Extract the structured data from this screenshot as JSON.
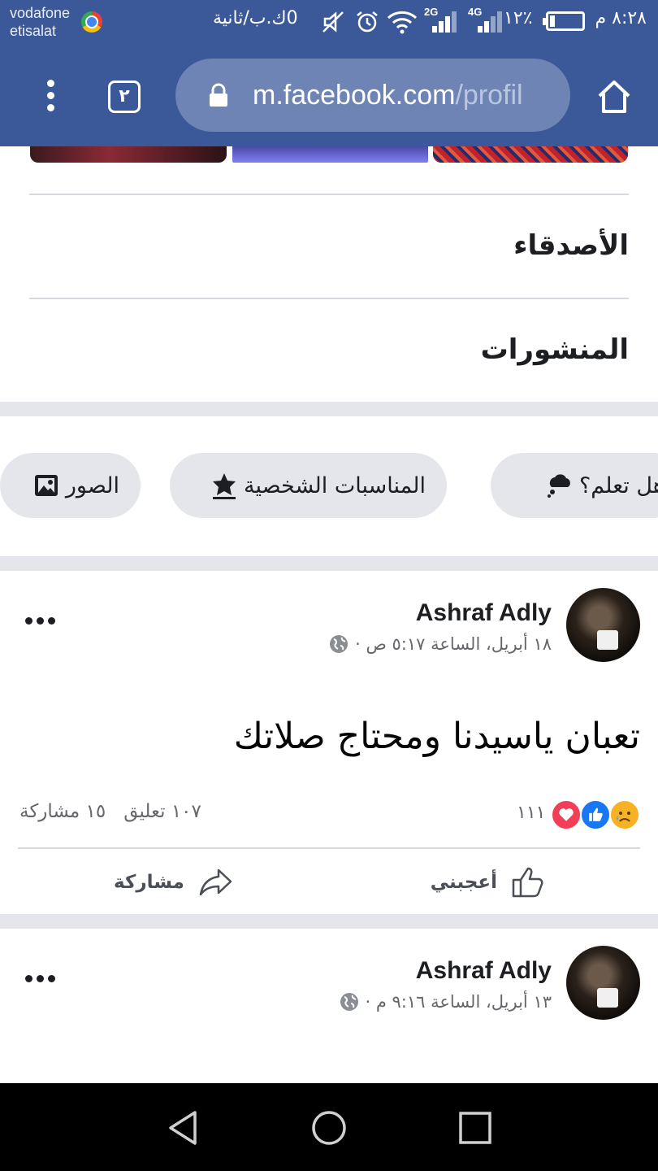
{
  "status_bar": {
    "carrier_line1": "vodafone",
    "carrier_line2": "etisalat",
    "speed": "0ك.ب/ثانية",
    "net1": "2G",
    "net2": "4G",
    "battery_pct": "٪١٢",
    "battery_level": 0.12,
    "time": "٨:٢٨ م"
  },
  "browser": {
    "tab_count": "٢",
    "url_host": "m.facebook.com",
    "url_path": "/profil"
  },
  "sections": {
    "friends": "الأصدقاء",
    "posts": "المنشورات"
  },
  "chips": [
    {
      "label": "هل تعلم؟",
      "icon": "thought-bubble-icon"
    },
    {
      "label": "المناسبات الشخصية",
      "icon": "star-event-icon"
    },
    {
      "label": "الصور",
      "icon": "photos-icon"
    }
  ],
  "posts": [
    {
      "author": "Ashraf Adly",
      "date": "١٨ أبريل، الساعة ٥:١٧ ص ·",
      "text": "تعبان ياسيدنا ومحتاج صلاتك",
      "reaction_count": "١١١",
      "comments": "١٠٧ تعليق",
      "shares": "١٥ مشاركة"
    },
    {
      "author": "Ashraf Adly",
      "date": "١٣ أبريل، الساعة ٩:١٦ م ·"
    }
  ],
  "actions": {
    "like": "أعجبني",
    "share": "مشاركة"
  },
  "colors": {
    "facebook_blue": "#3b5998",
    "like_blue": "#1877f2",
    "love_red": "#f33e58"
  }
}
